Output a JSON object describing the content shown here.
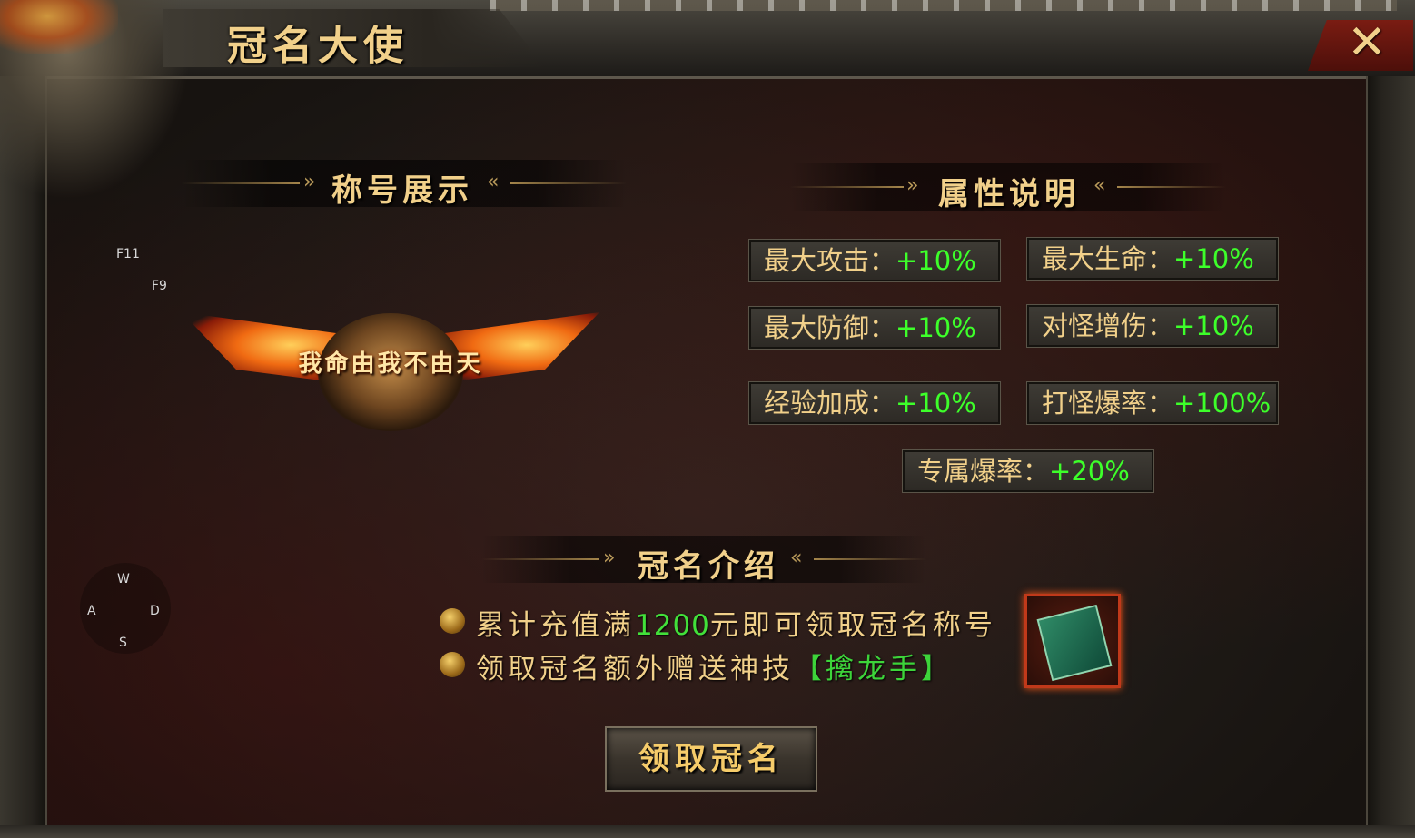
{
  "window": {
    "title": "冠名大使",
    "close_icon": "close-icon"
  },
  "key_hints": {
    "f11": "F11",
    "f9": "F9",
    "w": "W",
    "a": "A",
    "s": "S",
    "d": "D"
  },
  "sections": {
    "title_display": "称号展示",
    "attributes": "属性说明",
    "intro": "冠名介绍"
  },
  "badge": {
    "text": "我命由我不由天"
  },
  "attributes": [
    {
      "label": "最大攻击：",
      "value": "+10%"
    },
    {
      "label": "最大生命：",
      "value": "+10%"
    },
    {
      "label": "最大防御：",
      "value": "+10%"
    },
    {
      "label": "对怪增伤：",
      "value": "+10%"
    },
    {
      "label": "经验加成：",
      "value": "+10%"
    },
    {
      "label": "打怪爆率：",
      "value": "+100%"
    },
    {
      "label": "专属爆率：",
      "value": "+20%"
    }
  ],
  "intro": {
    "line1_prefix": "累计充值满",
    "line1_amount": "1200",
    "line1_suffix": "元即可领取冠名称号",
    "line2_prefix": "领取冠名额外赠送神技",
    "line2_skill": "【擒龙手】"
  },
  "reward_item": {
    "icon": "skill-book-icon"
  },
  "claim_button": {
    "label": "领取冠名"
  },
  "colors": {
    "gold": "#f1d08a",
    "green": "#3dff2a",
    "frame": "#3a372f",
    "accent_red": "#c0391a"
  }
}
